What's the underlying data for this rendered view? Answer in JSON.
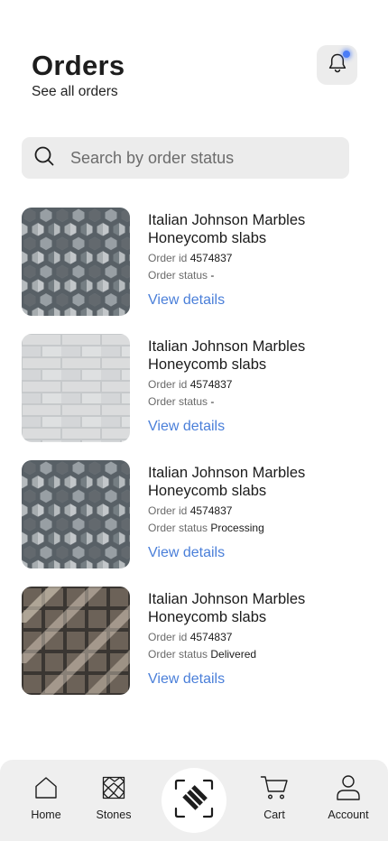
{
  "header": {
    "title": "Orders",
    "subtitle": "See all orders"
  },
  "search": {
    "placeholder": "Search by order status",
    "value": ""
  },
  "orders": [
    {
      "title": "Italian Johnson Marbles Honeycomb slabs",
      "order_id_label": "Order id",
      "order_id": "4574837",
      "status_label": "Order status",
      "status": "-",
      "link": "View details",
      "image": "hexagon-marble-tile"
    },
    {
      "title": "Italian Johnson Marbles Honeycomb slabs",
      "order_id_label": "Order id",
      "order_id": "4574837",
      "status_label": "Order status",
      "status": "-",
      "link": "View details",
      "image": "white-stone-wall"
    },
    {
      "title": "Italian Johnson Marbles Honeycomb slabs",
      "order_id_label": "Order id",
      "order_id": "4574837",
      "status_label": "Order status",
      "status": "Processing",
      "link": "View details",
      "image": "hexagon-marble-tile"
    },
    {
      "title": "Italian Johnson Marbles Honeycomb slabs",
      "order_id_label": "Order id",
      "order_id": "4574837",
      "status_label": "Order status",
      "status": "Delivered",
      "link": "View details",
      "image": "dark-grid-tile"
    }
  ],
  "nav": {
    "items": [
      {
        "label": "Home",
        "icon": "home-icon"
      },
      {
        "label": "Stones",
        "icon": "stones-icon"
      },
      {
        "label": "Cart",
        "icon": "cart-icon"
      },
      {
        "label": "Account",
        "icon": "account-icon"
      }
    ],
    "center_icon": "scan-icon"
  },
  "colors": {
    "accent": "#4a7fd9",
    "notification_dot": "#4a7cf7",
    "surface": "#ececec",
    "nav_background": "#efefef"
  }
}
